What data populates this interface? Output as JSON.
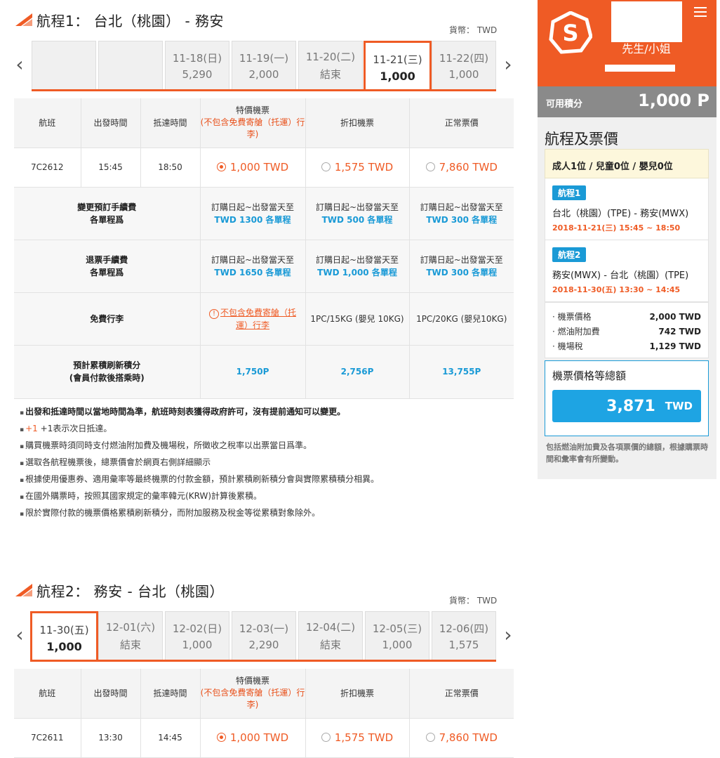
{
  "leg1": {
    "title": "航程1： 台北（桃園） - 務安",
    "currency": "貨幣： TWD",
    "dates": [
      {
        "d": "",
        "p": ""
      },
      {
        "d": "",
        "p": ""
      },
      {
        "d": "11-18(日)",
        "p": "5,290"
      },
      {
        "d": "11-19(一)",
        "p": "2,000"
      },
      {
        "d": "11-20(二)",
        "p": "結束"
      },
      {
        "d": "11-21(三)",
        "p": "1,000"
      },
      {
        "d": "11-22(四)",
        "p": "1,000"
      }
    ],
    "active_index": 5,
    "flight": {
      "no": "7C2612",
      "dep": "15:45",
      "arr": "18:50"
    },
    "fares": [
      "1,000 TWD",
      "1,575 TWD",
      "7,860 TWD"
    ]
  },
  "leg2": {
    "title": "航程2： 務安 - 台北（桃園）",
    "currency": "貨幣： TWD",
    "dates": [
      {
        "d": "11-30(五)",
        "p": "1,000"
      },
      {
        "d": "12-01(六)",
        "p": "結束"
      },
      {
        "d": "12-02(日)",
        "p": "1,000"
      },
      {
        "d": "12-03(一)",
        "p": "2,290"
      },
      {
        "d": "12-04(二)",
        "p": "結束"
      },
      {
        "d": "12-05(三)",
        "p": "1,000"
      },
      {
        "d": "12-06(四)",
        "p": "1,575"
      }
    ],
    "active_index": 0,
    "flight": {
      "no": "7C2611",
      "dep": "13:30",
      "arr": "14:45"
    },
    "fares": [
      "1,000 TWD",
      "1,575 TWD",
      "7,860 TWD"
    ]
  },
  "table_headers": {
    "flight": "航班",
    "dep": "出發時間",
    "arr": "抵達時間",
    "special_1": "特價機票",
    "special_2": "(不包含免費寄艙（托運）行",
    "special_3": "李)",
    "discount": "折扣機票",
    "regular": "正常票價"
  },
  "change_fee": {
    "label1": "變更預訂手續費",
    "label2": "各單程爲",
    "period": "訂購日起~出發當天至",
    "vals": [
      "TWD 1300 各單程",
      "TWD 500 各單程",
      "TWD 300 各單程"
    ]
  },
  "refund_fee": {
    "label1": "退票手續費",
    "label2": "各單程爲",
    "period": "訂購日起~出發當天至",
    "vals": [
      "TWD 1650 各單程",
      "TWD 1,000 各單程",
      "TWD 300 各單程"
    ]
  },
  "baggage": {
    "label": "免費行李",
    "special_1": "不包含免費寄艙（托",
    "special_2": "運）行李",
    "discount": "1PC/15KG (嬰兒 10KG)",
    "regular": "1PC/20KG (嬰兒10KG)"
  },
  "points": {
    "label1": "預計累積刷新積分",
    "label2": "(會員付款後搭乘時)",
    "vals": [
      "1,750P",
      "2,756P",
      "13,755P"
    ]
  },
  "notes": [
    "出發和抵達時間以當地時間為準，航班時刻表獲得政府許可，沒有提前通知可以變更。",
    "+1表示次日抵達。",
    "購買機票時須同時支付燃油附加費及機場稅，所徵收之稅率以出票當日爲準。",
    "選取各航程機票後，總票價會於網頁右側詳細顯示",
    "根據使用優惠券、適用彙率等最終機票的付款金額，預計累積刷新積分會與實際累積積分相異。",
    "在國外購票時，按照其國家規定的彙率韓元(KRW)計算後累積。",
    "限於實際付款的機票價格累積刷新積分，而附加服務及稅金等從累積對象除外。"
  ],
  "plus1": "+1",
  "sidebar": {
    "user": "先生/小姐",
    "points_label": "可用積分",
    "points_value": "1,000 P",
    "heading": "航程及票價",
    "pax": "成人1位 / 兒童0位 / 嬰兒0位",
    "leg1_tag": "航程1",
    "leg1_route": "台北（桃園）(TPE) - 務安(MWX)",
    "leg1_dt": "2018-11-21(三) 15:45 ~ 18:50",
    "leg2_tag": "航程2",
    "leg2_route": "務安(MWX) - 台北（桃園）(TPE)",
    "leg2_dt": "2018-11-30(五) 13:30 ~ 14:45",
    "fares": [
      {
        "n": "機票價格",
        "v": "2,000 TWD"
      },
      {
        "n": "燃油附加費",
        "v": "742 TWD"
      },
      {
        "n": "機場稅",
        "v": "1,129 TWD"
      }
    ],
    "total_label": "機票價格等總額",
    "total_value": "3,871",
    "total_unit": "TWD",
    "footnote": "包括燃油附加費及各項票價的總額，根據購票時間和彙率會有所變動。"
  },
  "colors": {
    "accent": "#ef5b25",
    "blue": "#1a9ad6"
  }
}
